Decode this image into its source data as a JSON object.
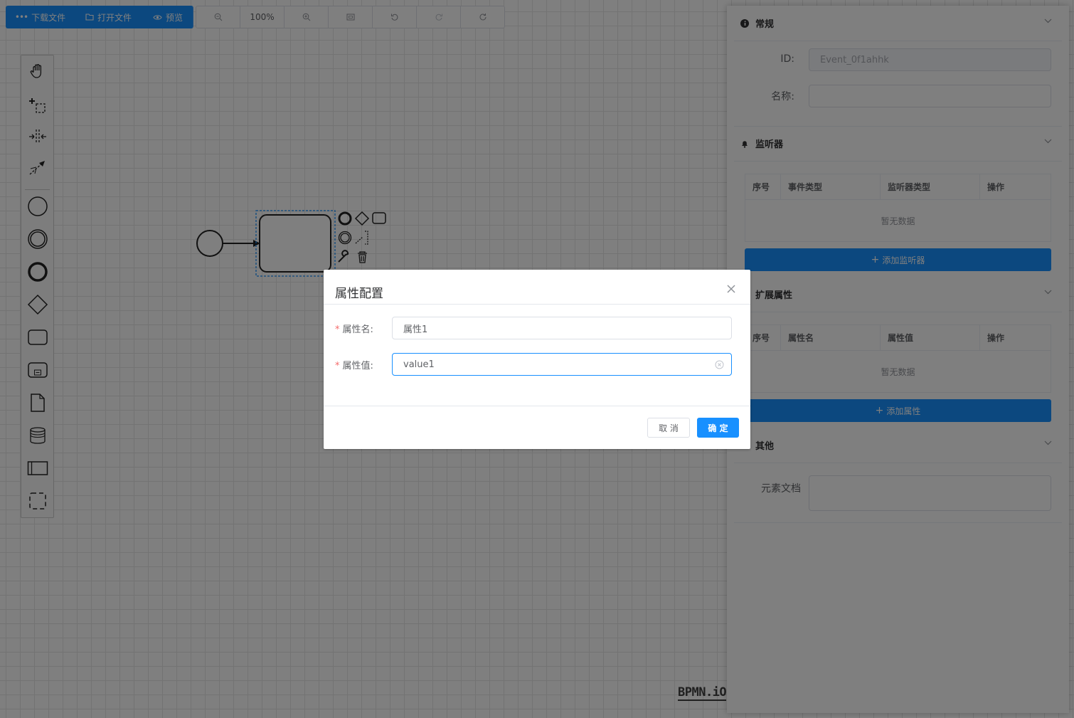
{
  "toolbar": {
    "download_label": "下载文件",
    "open_label": "打开文件",
    "preview_label": "预览",
    "zoom_level": "100%"
  },
  "palette": {
    "tools": [
      "hand-tool-icon",
      "lasso-tool-icon",
      "space-tool-icon",
      "global-connect-icon"
    ],
    "shapes": [
      "start-event-icon",
      "intermediate-event-icon",
      "end-event-icon",
      "gateway-icon",
      "task-icon",
      "subprocess-icon",
      "data-object-icon",
      "data-store-icon",
      "participant-icon",
      "group-icon"
    ]
  },
  "watermark": "BPMN.iO",
  "panel": {
    "general": {
      "title": "常规",
      "id_label": "ID:",
      "id_value": "Event_0f1ahhk",
      "name_label": "名称:",
      "name_value": ""
    },
    "listeners": {
      "title": "监听器",
      "columns": [
        "序号",
        "事件类型",
        "监听器类型",
        "操作"
      ],
      "empty_text": "暂无数据",
      "add_label": "添加监听器"
    },
    "extensions": {
      "title": "扩展属性",
      "columns": [
        "序号",
        "属性名",
        "属性值",
        "操作"
      ],
      "empty_text": "暂无数据",
      "add_label": "添加属性"
    },
    "other": {
      "title": "其他",
      "doc_label": "元素文档",
      "doc_value": ""
    }
  },
  "dialog": {
    "title": "属性配置",
    "name_label": "属性名:",
    "name_value": "属性1",
    "value_label": "属性值:",
    "value_value": "value1",
    "cancel_label": "取 消",
    "confirm_label": "确 定"
  },
  "colors": {
    "primary": "#1890ff",
    "required": "#f56c6c"
  }
}
